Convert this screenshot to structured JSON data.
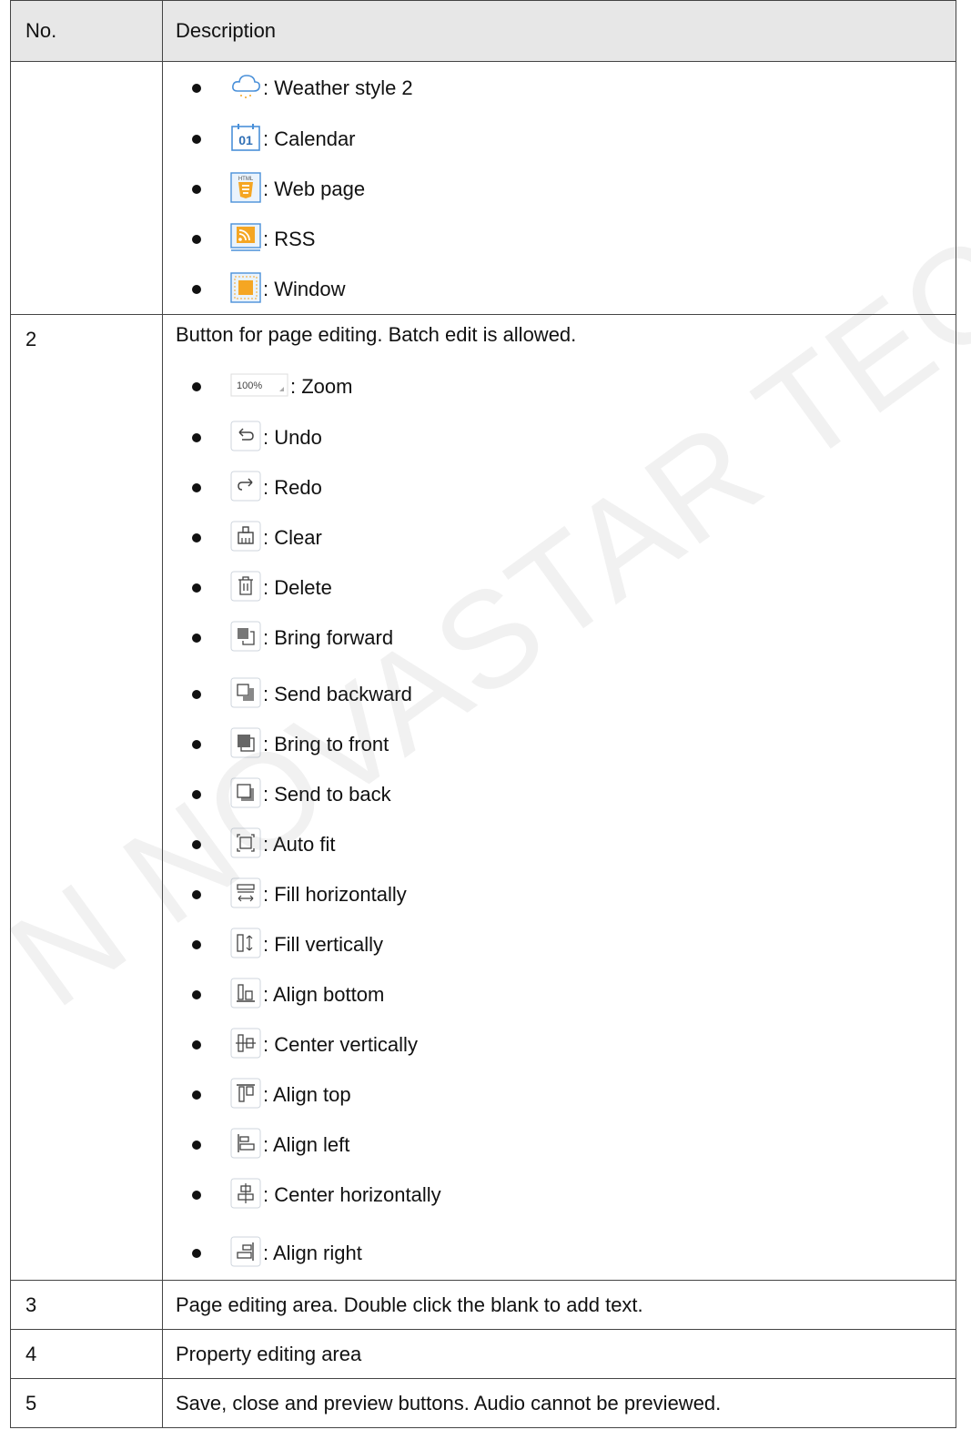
{
  "header": {
    "no": "No.",
    "description": "Description"
  },
  "row1": {
    "items": [
      {
        "icon": "weather-cloud-icon",
        "label": ": Weather style 2"
      },
      {
        "icon": "calendar-icon",
        "label": ": Calendar"
      },
      {
        "icon": "html5-icon",
        "label": ": Web page"
      },
      {
        "icon": "rss-icon",
        "label": ": RSS"
      },
      {
        "icon": "window-icon",
        "label": ": Window"
      }
    ],
    "calendar_number": "01",
    "html_badge": "HTML"
  },
  "row2": {
    "no": "2",
    "intro": "Button for page editing. Batch edit is allowed.",
    "zoom_value": "100%",
    "items": [
      {
        "icon": "zoom-select-icon",
        "label": ": Zoom"
      },
      {
        "icon": "undo-icon",
        "label": ": Undo"
      },
      {
        "icon": "redo-icon",
        "label": ": Redo"
      },
      {
        "icon": "clear-brush-icon",
        "label": ": Clear"
      },
      {
        "icon": "trash-icon",
        "label": ": Delete"
      },
      {
        "icon": "bring-forward-icon",
        "label": ": Bring forward"
      },
      {
        "icon": "send-backward-icon",
        "label": ": Send backward"
      },
      {
        "icon": "bring-to-front-icon",
        "label": ": Bring to front"
      },
      {
        "icon": "send-to-back-icon",
        "label": ": Send to back"
      },
      {
        "icon": "auto-fit-icon",
        "label": ": Auto fit"
      },
      {
        "icon": "fill-horizontal-icon",
        "label": ": Fill horizontally"
      },
      {
        "icon": "fill-vertical-icon",
        "label": ": Fill vertically"
      },
      {
        "icon": "align-bottom-icon",
        "label": ": Align bottom"
      },
      {
        "icon": "center-vertical-icon",
        "label": ": Center vertically"
      },
      {
        "icon": "align-top-icon",
        "label": ": Align top"
      },
      {
        "icon": "align-left-icon",
        "label": ": Align left"
      },
      {
        "icon": "center-horizontal-icon",
        "label": ": Center horizontally"
      },
      {
        "icon": "align-right-icon",
        "label": ": Align right"
      }
    ]
  },
  "row3": {
    "no": "3",
    "description": "Page editing area. Double click the blank to add text."
  },
  "row4": {
    "no": "4",
    "description": "Property editing area"
  },
  "row5": {
    "no": "5",
    "description": "Save, close and preview buttons. Audio cannot be previewed."
  },
  "watermark": "N NOVASTAR TECH CO.,LTD"
}
